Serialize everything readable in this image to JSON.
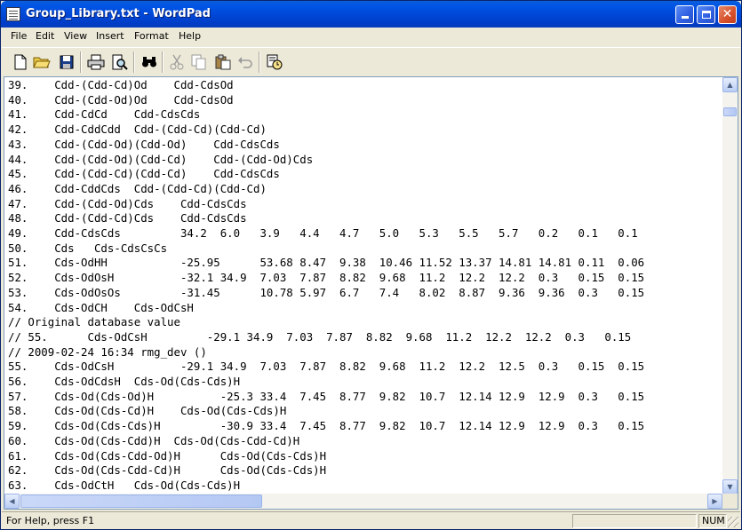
{
  "window": {
    "title": "Group_Library.txt - WordPad",
    "controls": {
      "minimize": "minimize",
      "maximize": "maximize",
      "close": "✕"
    }
  },
  "menu": [
    "File",
    "Edit",
    "View",
    "Insert",
    "Format",
    "Help"
  ],
  "toolbar": [
    "new-icon",
    "open-icon",
    "save-icon",
    "print-icon",
    "print-preview-icon",
    "find-icon",
    "cut-icon",
    "copy-icon",
    "paste-icon",
    "undo-icon",
    "insert-datetime-icon"
  ],
  "document": {
    "lines": [
      "39.    Cdd-(Cdd-Cd)Od    Cdd-CdsOd",
      "40.    Cdd-(Cdd-Od)Od    Cdd-CdsOd",
      "41.    Cdd-CdCd    Cdd-CdsCds",
      "42.    Cdd-CddCdd  Cdd-(Cdd-Cd)(Cdd-Cd)",
      "43.    Cdd-(Cdd-Od)(Cdd-Od)    Cdd-CdsCds",
      "44.    Cdd-(Cdd-Od)(Cdd-Cd)    Cdd-(Cdd-Od)Cds",
      "45.    Cdd-(Cdd-Cd)(Cdd-Cd)    Cdd-CdsCds",
      "46.    Cdd-CddCds  Cdd-(Cdd-Cd)(Cdd-Cd)",
      "47.    Cdd-(Cdd-Od)Cds    Cdd-CdsCds",
      "48.    Cdd-(Cdd-Cd)Cds    Cdd-CdsCds",
      "49.    Cdd-CdsCds         34.2  6.0   3.9   4.4   4.7   5.0   5.3   5.5   5.7   0.2   0.1   0.1",
      "50.    Cds   Cds-CdsCsCs",
      "51.    Cds-OdHH           -25.95      53.68 8.47  9.38  10.46 11.52 13.37 14.81 14.81 0.11  0.06",
      "52.    Cds-OdOsH          -32.1 34.9  7.03  7.87  8.82  9.68  11.2  12.2  12.2  0.3   0.15  0.15",
      "53.    Cds-OdOsOs         -31.45      10.78 5.97  6.7   7.4   8.02  8.87  9.36  9.36  0.3   0.15",
      "54.    Cds-OdCH    Cds-OdCsH",
      "// Original database value",
      "// 55.      Cds-OdCsH         -29.1 34.9  7.03  7.87  8.82  9.68  11.2  12.2  12.2  0.3   0.15",
      "// 2009-02-24 16:34 rmg_dev ()",
      "55.    Cds-OdCsH          -29.1 34.9  7.03  7.87  8.82  9.68  11.2  12.2  12.5  0.3   0.15  0.15",
      "56.    Cds-OdCdsH  Cds-Od(Cds-Cds)H",
      "57.    Cds-Od(Cds-Od)H          -25.3 33.4  7.45  8.77  9.82  10.7  12.14 12.9  12.9  0.3   0.15",
      "58.    Cds-Od(Cds-Cd)H    Cds-Od(Cds-Cds)H",
      "59.    Cds-Od(Cds-Cds)H         -30.9 33.4  7.45  8.77  9.82  10.7  12.14 12.9  12.9  0.3   0.15",
      "60.    Cds-Od(Cds-Cdd)H  Cds-Od(Cds-Cdd-Cd)H",
      "61.    Cds-Od(Cds-Cdd-Od)H      Cds-Od(Cds-Cds)H",
      "62.    Cds-Od(Cds-Cdd-Cd)H      Cds-Od(Cds-Cds)H",
      "63.    Cds-OdCtH   Cds-Od(Cds-Cds)H"
    ]
  },
  "scrollbars": {
    "up": "▲",
    "down": "▼",
    "left": "◀",
    "right": "▶"
  },
  "status": {
    "help": "For Help, press F1",
    "num": "NUM"
  }
}
